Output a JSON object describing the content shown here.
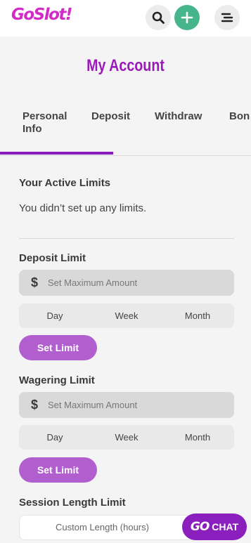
{
  "header": {
    "logo_text": "GoSlot!",
    "icons": [
      "search-icon",
      "plus-icon",
      "menu-icon"
    ],
    "colors": {
      "brand": "#8a14c9",
      "add_button": "#46b58c"
    }
  },
  "page_title": "My Account",
  "tabs": [
    {
      "label": "Personal Info",
      "active": true
    },
    {
      "label": "Deposit"
    },
    {
      "label": "Withdraw"
    },
    {
      "label": "Bon"
    }
  ],
  "active_limits": {
    "title": "Your Active Limits",
    "message": "You didn’t set up any limits."
  },
  "deposit_limit": {
    "title": "Deposit Limit",
    "currency_symbol": "$",
    "placeholder": "Set Maximum Amount",
    "periods": [
      "Day",
      "Week",
      "Month"
    ],
    "button": "Set Limit"
  },
  "wagering_limit": {
    "title": "Wagering Limit",
    "currency_symbol": "$",
    "placeholder": "Set Maximum Amount",
    "periods": [
      "Day",
      "Week",
      "Month"
    ],
    "button": "Set Limit"
  },
  "session_limit": {
    "title": "Session Length Limit",
    "placeholder": "Custom Length (hours)"
  },
  "chat": {
    "go": "GO",
    "label": "CHAT"
  }
}
